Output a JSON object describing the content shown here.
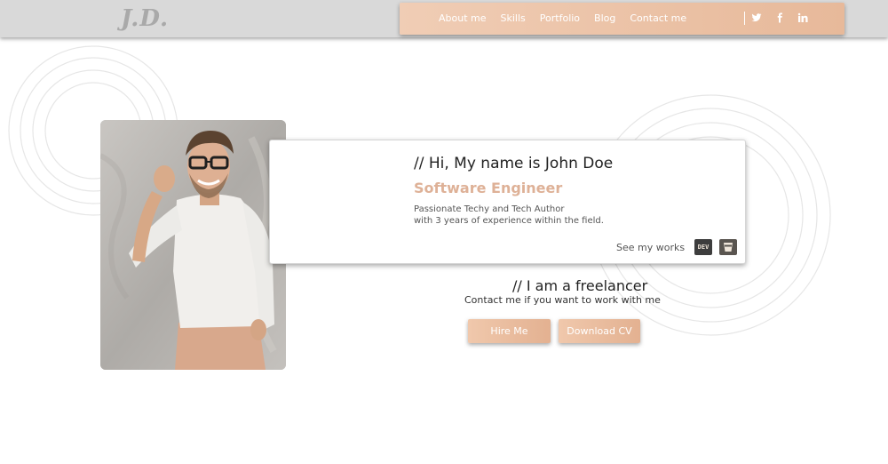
{
  "header": {
    "logo": "J.D.",
    "nav": [
      "About me",
      "Skills",
      "Portfolio",
      "Blog",
      "Contact me"
    ],
    "social_icons": [
      "twitter-icon",
      "facebook-icon",
      "linkedin-icon"
    ]
  },
  "hero": {
    "greeting": "// Hi, My name is John Doe",
    "role": "Software Engineer",
    "description_line1": "Passionate Techy and Tech Author",
    "description_line2": "with 3 years of experience within the field.",
    "see_works": "See my works",
    "dev_badge": "DEV"
  },
  "freelance": {
    "title": "// I am a freelancer",
    "subtitle": "Contact me if you want to work with me",
    "hire_label": "Hire Me",
    "cv_label": "Download CV"
  },
  "colors": {
    "accent": "#deb197",
    "nav_gradient_start": "#f0cdb5",
    "nav_gradient_end": "#e7b99a",
    "header_bg": "#d9d9d9"
  }
}
